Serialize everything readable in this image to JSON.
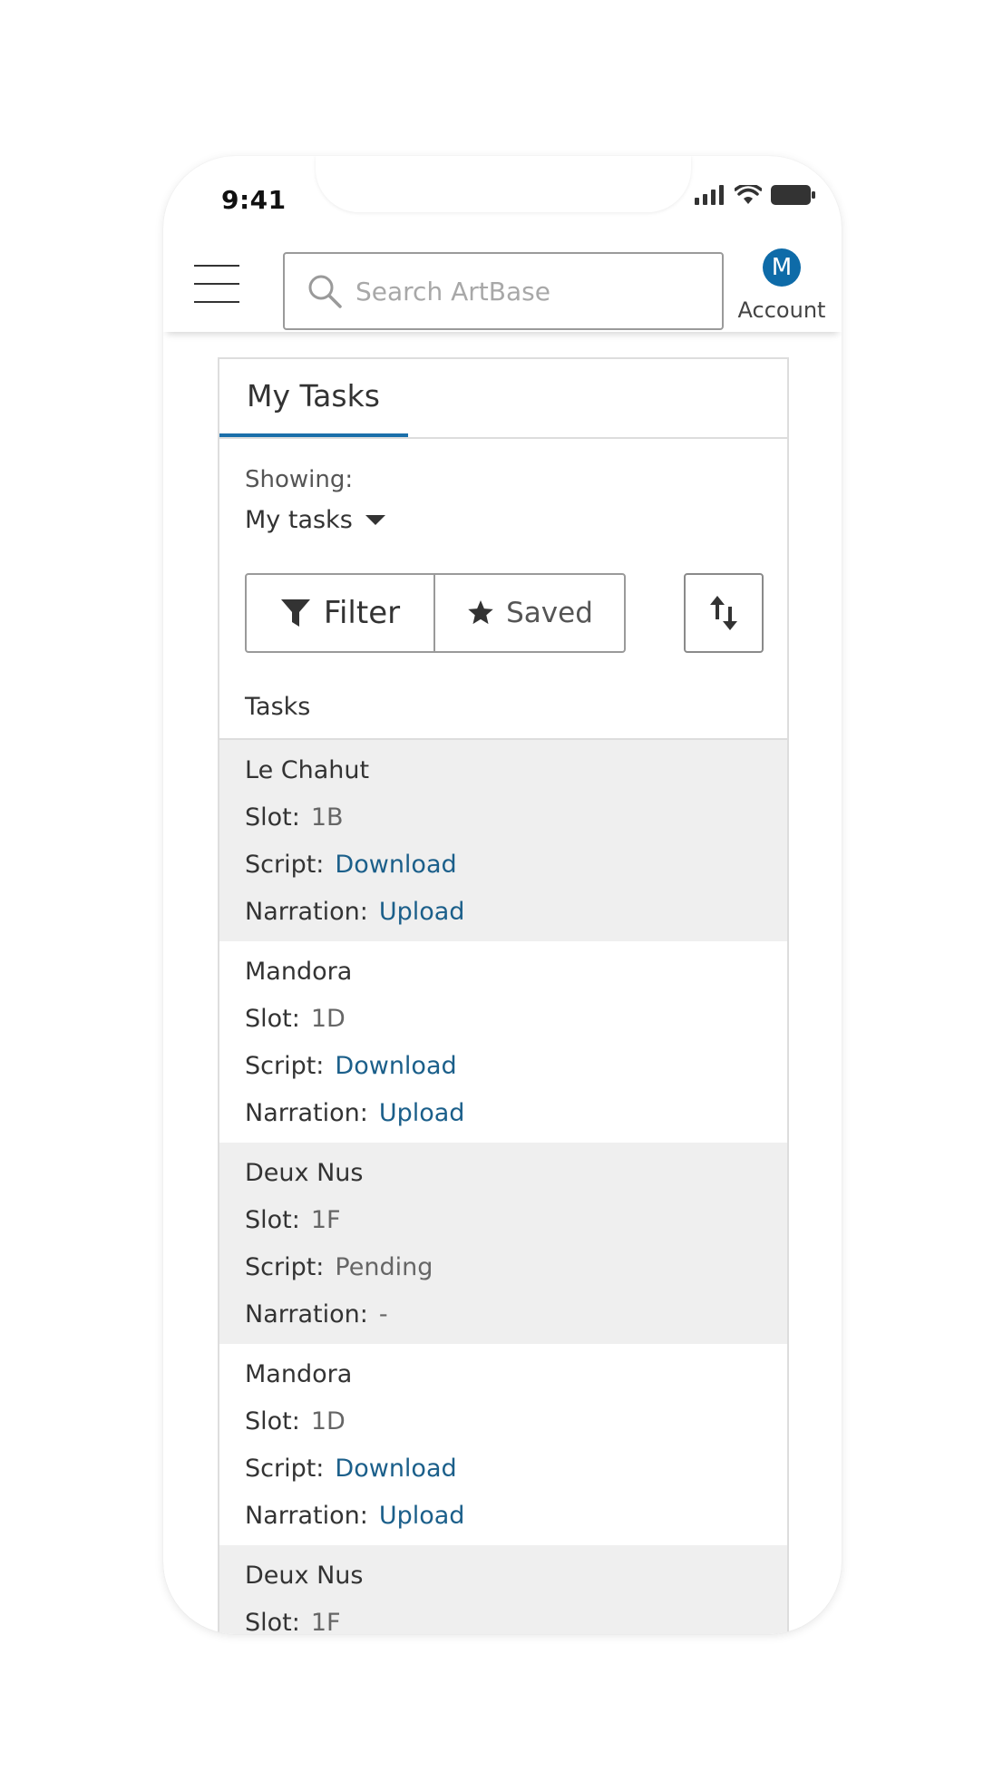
{
  "status_bar": {
    "time": "9:41"
  },
  "header": {
    "search_placeholder": "Search ArtBase",
    "avatar_initial": "M",
    "account_label": "Account"
  },
  "tabs": [
    {
      "label": "My Tasks",
      "active": true
    }
  ],
  "filters": {
    "showing_label": "Showing:",
    "showing_value": "My tasks",
    "filter_label": "Filter",
    "saved_label": "Saved"
  },
  "tasks_heading": "Tasks",
  "tasks": [
    {
      "title": "Le Chahut",
      "slot_label": "Slot:",
      "slot": "1B",
      "script_label": "Script:",
      "script": "Download",
      "script_is_link": true,
      "narration_label": "Narration:",
      "narration": "Upload",
      "narration_is_link": true
    },
    {
      "title": "Mandora",
      "slot_label": "Slot:",
      "slot": "1D",
      "script_label": "Script:",
      "script": "Download",
      "script_is_link": true,
      "narration_label": "Narration:",
      "narration": "Upload",
      "narration_is_link": true
    },
    {
      "title": "Deux Nus",
      "slot_label": "Slot:",
      "slot": "1F",
      "script_label": "Script:",
      "script": "Pending",
      "script_is_link": false,
      "narration_label": "Narration:",
      "narration": "-",
      "narration_is_link": false
    },
    {
      "title": "Mandora",
      "slot_label": "Slot:",
      "slot": "1D",
      "script_label": "Script:",
      "script": "Download",
      "script_is_link": true,
      "narration_label": "Narration:",
      "narration": "Upload",
      "narration_is_link": true
    },
    {
      "title": "Deux Nus",
      "slot_label": "Slot:",
      "slot": "1F"
    }
  ],
  "colors": {
    "accent": "#1b6faa",
    "link": "#1b5f8a",
    "avatar": "#0e6ba8",
    "shaded_row": "#efefef"
  },
  "icons": {
    "menu": "hamburger-icon",
    "search": "search-icon",
    "filter": "funnel-icon",
    "saved": "star-icon",
    "sort": "sort-arrows-icon",
    "dropdown": "caret-down-icon"
  }
}
